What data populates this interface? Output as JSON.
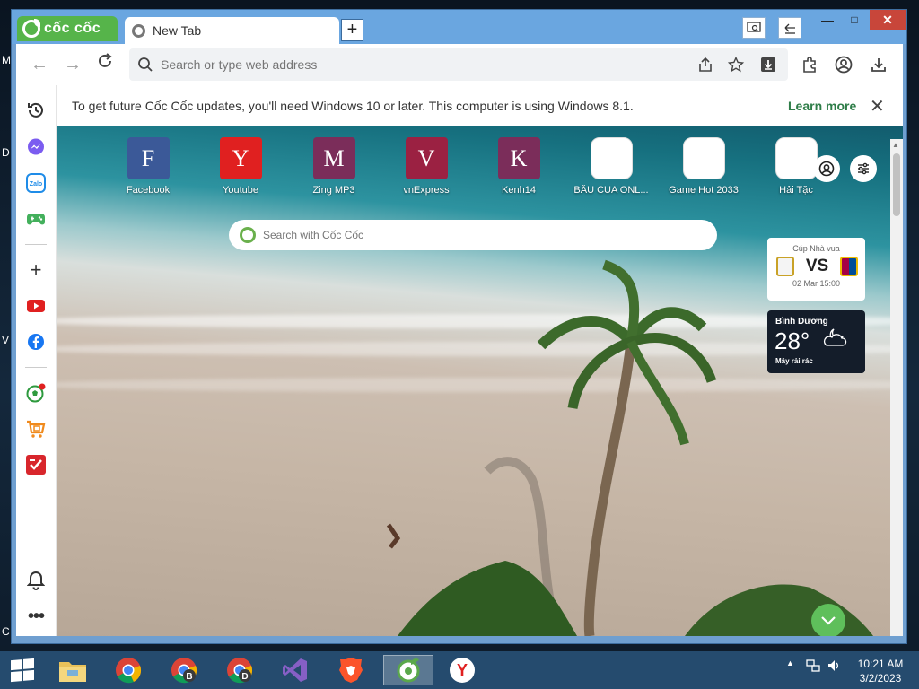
{
  "desktop": {
    "edge_letters": [
      "M",
      "D",
      "V",
      "C"
    ]
  },
  "browser": {
    "logo_text": "cốc cốc",
    "tab_title": "New Tab",
    "new_tab_symbol": "+",
    "window_controls": {
      "minimize": "—",
      "maximize": "□",
      "close": "✕"
    }
  },
  "toolbar": {
    "omnibox_placeholder": "Search or type web address"
  },
  "notice": {
    "text": "To get future Cốc Cốc updates, you'll need Windows 10 or later. This computer is using Windows 8.1.",
    "link": "Learn more",
    "close_symbol": "✕"
  },
  "speed_dial": [
    {
      "letter": "F",
      "label": "Facebook",
      "color": "#3b5998"
    },
    {
      "letter": "Y",
      "label": "Youtube",
      "color": "#e02020"
    },
    {
      "letter": "M",
      "label": "Zing MP3",
      "color": "#7b2d5a"
    },
    {
      "letter": "V",
      "label": "vnExpress",
      "color": "#9b2142"
    },
    {
      "letter": "K",
      "label": "Kenh14",
      "color": "#7b2d5a"
    },
    {
      "letter": "",
      "label": "BẦU CUA ONL...",
      "color": "#ffffff"
    },
    {
      "letter": "",
      "label": "Game Hot 2033",
      "color": "#ffffff"
    },
    {
      "letter": "",
      "label": "Hải Tặc",
      "color": "#ffffff"
    }
  ],
  "search": {
    "placeholder": "Search with Cốc Cốc"
  },
  "match": {
    "title": "Cúp Nhà vua",
    "vs": "VS",
    "date": "02 Mar 15:00"
  },
  "weather": {
    "city": "Bình Dương",
    "temp": "28°",
    "desc": "Mây rải rác"
  },
  "taskbar": {
    "time": "10:21 AM",
    "date": "3/2/2023",
    "apps": [
      {
        "name": "file-explorer"
      },
      {
        "name": "chrome"
      },
      {
        "name": "chrome-b",
        "badge": "B"
      },
      {
        "name": "chrome-d",
        "badge": "D"
      },
      {
        "name": "visual-studio"
      },
      {
        "name": "brave"
      },
      {
        "name": "coccoc"
      },
      {
        "name": "yandex",
        "badge": "Y"
      }
    ]
  }
}
